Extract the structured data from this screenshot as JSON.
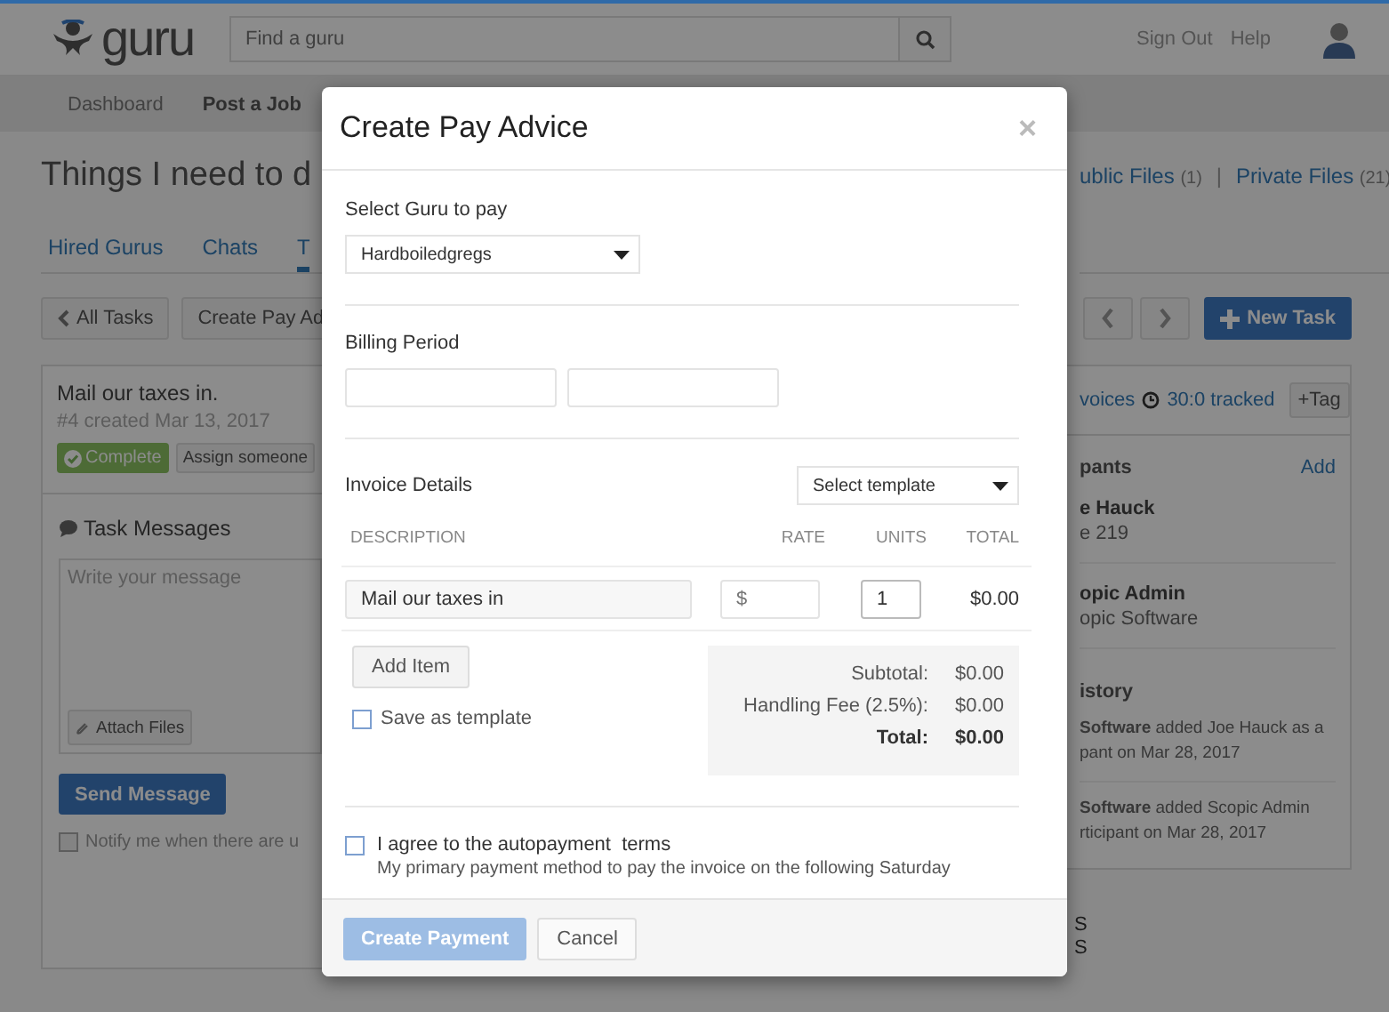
{
  "header": {
    "logo": "guru",
    "search": {
      "placeholder": "Find a guru"
    },
    "links": [
      "Sign Out",
      "Help"
    ]
  },
  "nav": [
    "Dashboard",
    "Post a Job"
  ],
  "page": {
    "title": "Things I need to d",
    "files": [
      {
        "label": "ublic Files",
        "count": "(1)"
      },
      {
        "label": "Private Files",
        "count": "(21)"
      }
    ],
    "separator": "|"
  },
  "tabs": [
    {
      "label": "Hired Gurus",
      "selected": false
    },
    {
      "label": "Chats",
      "selected": false
    },
    {
      "label": "T",
      "selected": true
    }
  ],
  "toolbar": {
    "back": "All Tasks",
    "create": "Create Pay Ad",
    "new_task": "New Task"
  },
  "task": {
    "title": "Mail our taxes in.",
    "meta": "#4 created Mar 13, 2017",
    "complete": "Complete",
    "assign": "Assign someone",
    "invoices": "voices",
    "tracked": "30:0 tracked",
    "tag": "+Tag"
  },
  "messages": {
    "title": "Task Messages",
    "placeholder": "Write your message",
    "attach": "Attach Files",
    "send": "Send Message",
    "notify": {
      "label": "Notify me when there are u",
      "checked": false
    }
  },
  "participants": {
    "title": "pants",
    "add": "Add",
    "people": [
      {
        "name": "e Hauck",
        "detail": "e 219"
      },
      {
        "name": "opic Admin",
        "detail": "opic Software"
      }
    ]
  },
  "history": {
    "title": "istory",
    "entries": [
      {
        "lines": [
          "**Software** added Joe Hauck as a",
          "pant on Mar 28, 2017"
        ]
      },
      {
        "lines": [
          "**Software** added Scopic Admin",
          "rticipant on Mar 28, 2017"
        ]
      }
    ]
  },
  "stray": [
    "S",
    "S"
  ],
  "modal": {
    "title": "Create Pay Advice",
    "close": "×",
    "guru": {
      "label": "Select Guru to pay",
      "value": "Hardboiledgregs"
    },
    "billing": {
      "label": "Billing Period"
    },
    "invoice": {
      "label": "Invoice Details",
      "template": "Select template",
      "columns": [
        "DESCRIPTION",
        "RATE",
        "UNITS",
        "TOTAL"
      ],
      "items": [
        {
          "description": "Mail our taxes in",
          "rate_placeholder": "$",
          "units": "1",
          "total": "$0.00"
        }
      ],
      "add_item": "Add Item",
      "save_template": {
        "label": "Save as template",
        "checked": false
      },
      "summary": [
        {
          "label": "Subtotal:",
          "value": "$0.00",
          "kind": "normal"
        },
        {
          "label": "Handling Fee (2.5%):",
          "value": "$0.00",
          "kind": "normal"
        },
        {
          "label": "Total:",
          "value": "$0.00",
          "kind": "total"
        }
      ]
    },
    "agree": {
      "label": "I agree to the autopayment  terms",
      "note": "My primary payment method to pay the invoice on the following Saturday",
      "checked": false
    },
    "buttons": [
      {
        "label": "Create Payment",
        "kind": "primary",
        "disabled": true
      },
      {
        "label": "Cancel",
        "kind": "default",
        "disabled": false
      }
    ]
  }
}
